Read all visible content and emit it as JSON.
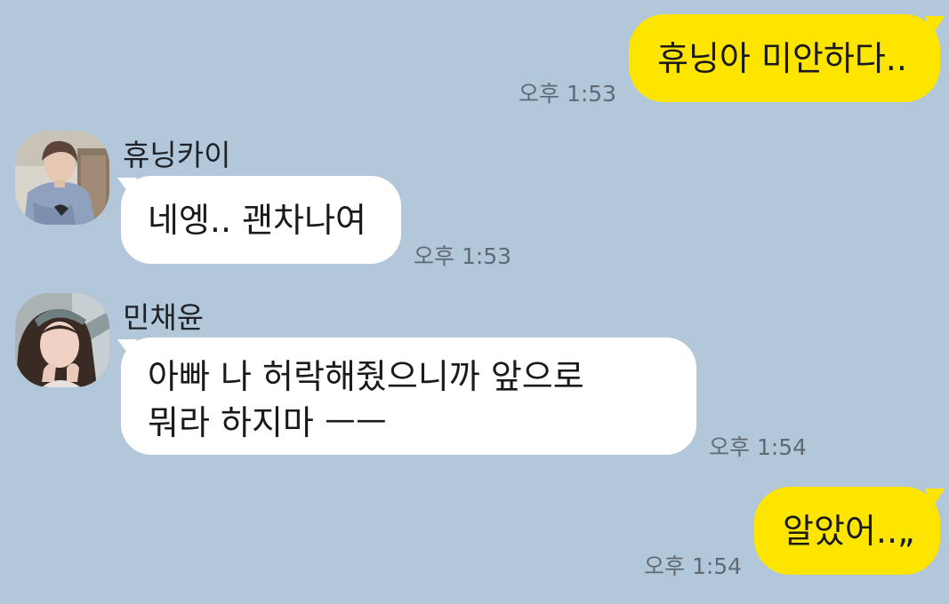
{
  "messages": [
    {
      "side": "mine",
      "text": "휴닝아 미안하다..",
      "time": "오후 1:53"
    },
    {
      "side": "theirs",
      "sender": "휴닝카이",
      "avatar": "avatar-photo-boy",
      "text": "네엥.. 괜차나여",
      "time": "오후 1:53"
    },
    {
      "side": "theirs",
      "sender": "민채윤",
      "avatar": "avatar-photo-girl",
      "lines": [
        "아빠 나 허락해줬으니까 앞으로",
        "뭐라 하지마 ㅡㅡ"
      ],
      "time": "오후 1:54"
    },
    {
      "side": "mine",
      "text": "알았어..„",
      "time": "오후 1:54"
    }
  ],
  "colors": {
    "background": "#b2c7da",
    "mine_bubble": "#fee500",
    "theirs_bubble": "#ffffff",
    "time_text": "#5f6a75"
  }
}
